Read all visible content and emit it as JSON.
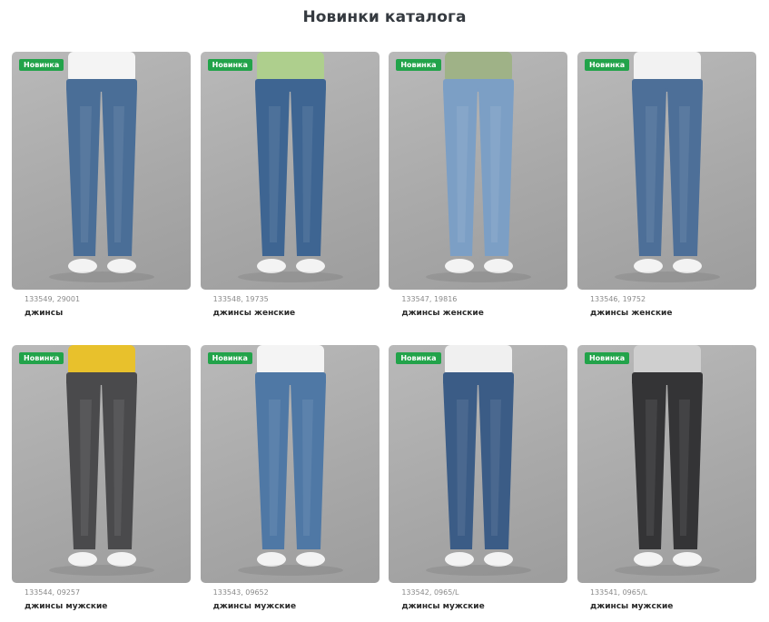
{
  "section": {
    "title": "Новинки каталога"
  },
  "products": [
    {
      "badge": "Новинка",
      "sku": "133549, 29001",
      "name": "джинсы",
      "image": "models-couple-jeans",
      "jean_color": "#4a6e97",
      "top_color": "#f4f4f4"
    },
    {
      "badge": "Новинка",
      "sku": "133548, 19735",
      "name": "джинсы женские",
      "image": "woman-jeans-straight",
      "jean_color": "#3e6592",
      "top_color": "#aecf8d"
    },
    {
      "badge": "Новинка",
      "sku": "133547, 19816",
      "name": "джинсы женские",
      "image": "woman-jeans-wide",
      "jean_color": "#7c9fc5",
      "top_color": "#9fb287"
    },
    {
      "badge": "Новинка",
      "sku": "133546, 19752",
      "name": "джинсы женские",
      "image": "woman-jeans-mom",
      "jean_color": "#4d6f98",
      "top_color": "#f2f2f2"
    },
    {
      "badge": "Новинка",
      "sku": "133544, 09257",
      "name": "джинсы мужские",
      "image": "man-jeans-grey",
      "jean_color": "#4a4a4c",
      "top_color": "#e8c12c"
    },
    {
      "badge": "Новинка",
      "sku": "133543, 09652",
      "name": "джинсы мужские",
      "image": "man-jeans-blue",
      "jean_color": "#4f78a5",
      "top_color": "#f4f4f4"
    },
    {
      "badge": "Новинка",
      "sku": "133542, 0965/L",
      "name": "джинсы мужские",
      "image": "man-jeans-dark-blue",
      "jean_color": "#3b5c86",
      "top_color": "#f0f0f0"
    },
    {
      "badge": "Новинка",
      "sku": "133541, 0965/L",
      "name": "джинсы мужские",
      "image": "man-jeans-black",
      "jean_color": "#343436",
      "top_color": "#cfcfcf"
    }
  ]
}
